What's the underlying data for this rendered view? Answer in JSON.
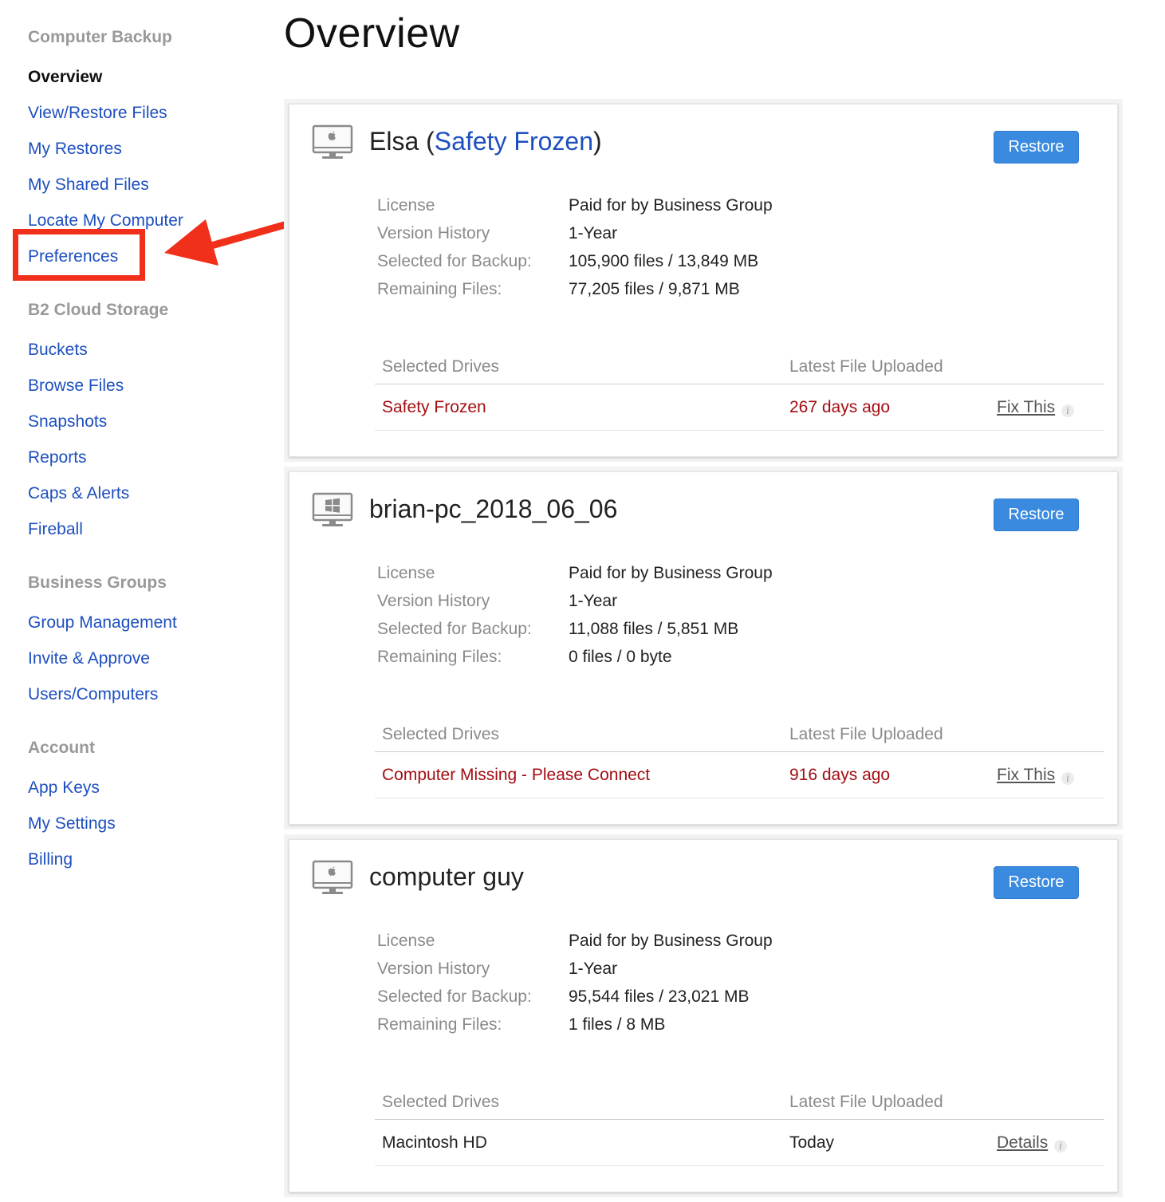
{
  "sidebar": {
    "groups": [
      {
        "heading": "Computer Backup",
        "items": [
          "Overview",
          "View/Restore Files",
          "My Restores",
          "My Shared Files",
          "Locate My Computer",
          "Preferences"
        ]
      },
      {
        "heading": "B2 Cloud Storage",
        "items": [
          "Buckets",
          "Browse Files",
          "Snapshots",
          "Reports",
          "Caps & Alerts",
          "Fireball"
        ]
      },
      {
        "heading": "Business Groups",
        "items": [
          "Group Management",
          "Invite & Approve",
          "Users/Computers"
        ]
      },
      {
        "heading": "Account",
        "items": [
          "App Keys",
          "My Settings",
          "Billing"
        ]
      }
    ],
    "active_item": "Overview"
  },
  "main": {
    "title": "Overview",
    "labels": {
      "license": "License",
      "version_history": "Version History",
      "selected_for_backup": "Selected for Backup:",
      "remaining_files": "Remaining Files:",
      "selected_drives": "Selected Drives",
      "latest_file_uploaded": "Latest File Uploaded",
      "restore": "Restore"
    },
    "computers": [
      {
        "os_icon": "apple-icon",
        "name": "Elsa (",
        "status": "Safety Frozen",
        "name_suffix": ")",
        "license": "Paid for by Business Group",
        "version_history": "1-Year",
        "selected_for_backup": "105,900 files / 13,849 MB",
        "remaining_files": "77,205 files / 9,871 MB",
        "drive": "Safety Frozen",
        "latest": "267 days ago",
        "action": "Fix This",
        "state": "warn"
      },
      {
        "os_icon": "windows-icon",
        "name": "brian-pc_2018_06_06",
        "status": "",
        "name_suffix": "",
        "license": "Paid for by Business Group",
        "version_history": "1-Year",
        "selected_for_backup": "11,088 files / 5,851 MB",
        "remaining_files": "0 files / 0 byte",
        "drive": "Computer Missing - Please Connect",
        "latest": "916 days ago",
        "action": "Fix This",
        "state": "warn"
      },
      {
        "os_icon": "apple-icon",
        "name": "computer guy",
        "status": "",
        "name_suffix": "",
        "license": "Paid for by Business Group",
        "version_history": "1-Year",
        "selected_for_backup": "95,544 files / 23,021 MB",
        "remaining_files": "1 files / 8 MB",
        "drive": "Macintosh HD",
        "latest": "Today",
        "action": "Details",
        "state": "ok"
      }
    ]
  },
  "colors": {
    "link": "#1d4fbf",
    "warning": "#a30d12",
    "button": "#3a8be0",
    "annotation": "#f0301a"
  }
}
